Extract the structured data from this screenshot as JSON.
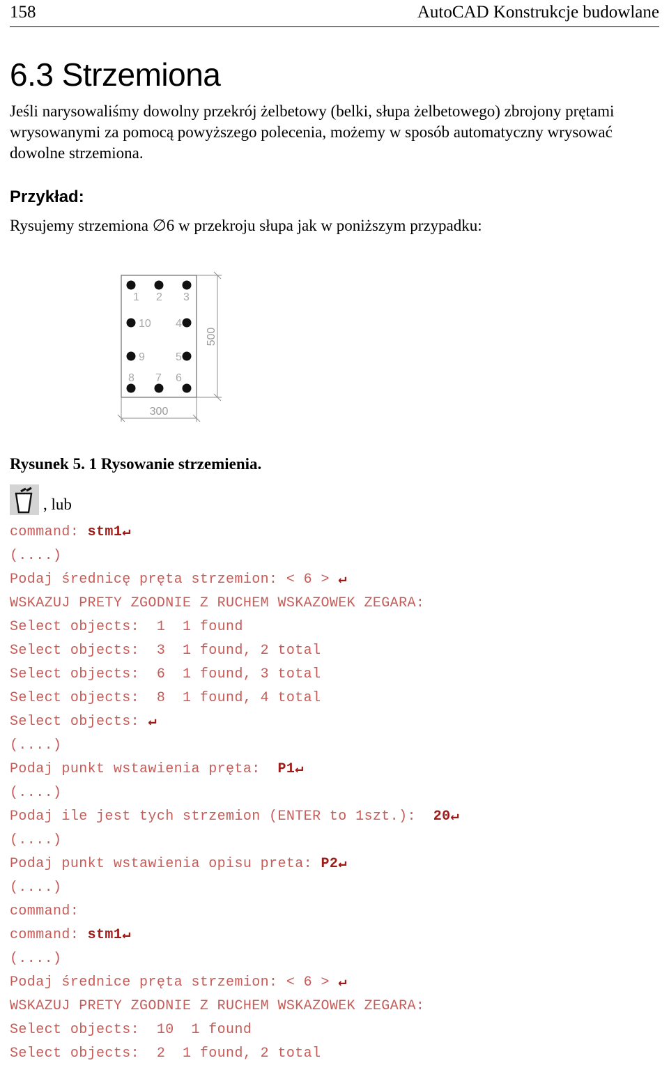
{
  "header": {
    "folio": "158",
    "book_title": "AutoCAD Konstrukcje budowlane"
  },
  "section": {
    "heading": "6.3 Strzemiona",
    "paragraph": "Jeśli narysowaliśmy dowolny przekrój żelbetowy (belki, słupa żelbetowego) zbrojony prętami wrysowanymi za pomocą powyższego polecenia, możemy w sposób automatyczny wrysować dowolne strzemiona.",
    "example_heading": "Przykład:",
    "example_lead": "Rysujemy strzemiona ∅6 w przekroju słupa jak w poniższym przypadku:"
  },
  "figure": {
    "caption": "Rysunek 5. 1 Rysowanie strzemienia.",
    "width_dim": "300",
    "height_dim": "500",
    "bar_labels": [
      "1",
      "2",
      "3",
      "4",
      "5",
      "6",
      "7",
      "8",
      "9",
      "10"
    ]
  },
  "toolbar": {
    "icon_name": "stirrup-tool-icon",
    "caption": ", lub"
  },
  "console": {
    "lines": [
      {
        "text": "command: ",
        "bold": "stm1",
        "ret": true
      },
      {
        "text": "(....)"
      },
      {
        "text": "Podaj średnicę pręta strzemion: < 6 > ",
        "ret": true
      },
      {
        "text": "WSKAZUJ PRETY ZGODNIE Z RUCHEM WSKAZOWEK ZEGARA:"
      },
      {
        "text": "Select objects:  1  1 found"
      },
      {
        "text": "Select objects:  3  1 found, 2 total"
      },
      {
        "text": "Select objects:  6  1 found, 3 total"
      },
      {
        "text": "Select objects:  8  1 found, 4 total"
      },
      {
        "text": "Select objects: ",
        "ret": true
      },
      {
        "text": "(....)"
      },
      {
        "text": "Podaj punkt wstawienia pręta:  ",
        "bold": "P1",
        "ret": true
      },
      {
        "text": "(....)"
      },
      {
        "text": "Podaj ile jest tych strzemion (ENTER to 1szt.):  ",
        "bold": "20",
        "ret": true
      },
      {
        "text": "(....)"
      },
      {
        "text": "Podaj punkt wstawienia opisu preta: ",
        "bold": "P2",
        "ret": true
      },
      {
        "text": "(....)"
      },
      {
        "text": "command:"
      },
      {
        "text": "command: ",
        "bold": "stm1",
        "ret": true
      },
      {
        "text": "(....)"
      },
      {
        "text": "Podaj średnice pręta strzemion: < 6 > ",
        "ret": true
      },
      {
        "text": "WSKAZUJ PRETY ZGODNIE Z RUCHEM WSKAZOWEK ZEGARA:"
      },
      {
        "text": "Select objects:  10  1 found"
      },
      {
        "text": "Select objects:  2  1 found, 2 total"
      }
    ],
    "return_glyph": "↵",
    "text_color": "#c75b57",
    "bold_color": "#9e1a17"
  }
}
